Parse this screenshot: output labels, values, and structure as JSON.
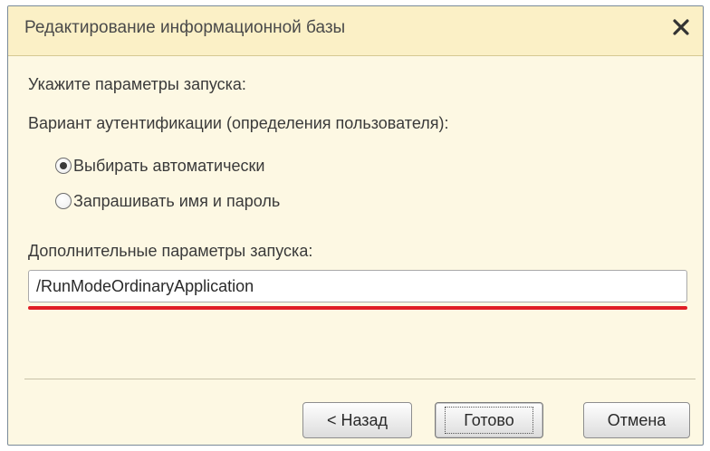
{
  "window": {
    "title": "Редактирование информационной базы",
    "close_symbol": "×",
    "close_icon": "close-icon"
  },
  "prompt": "Укажите параметры запуска:",
  "auth": {
    "label": "Вариант аутентификации (определения пользователя):",
    "options": [
      {
        "label": "Выбирать автоматически",
        "checked": true
      },
      {
        "label": "Запрашивать имя и пароль",
        "checked": false
      }
    ]
  },
  "extra_params": {
    "label": "Дополнительные параметры запуска:",
    "value": "/RunModeOrdinaryApplication",
    "highlight_color": "#e01e26"
  },
  "buttons": {
    "back": "< Назад",
    "finish": "Готово",
    "cancel": "Отмена"
  },
  "colors": {
    "window_bg": "#fdf8e3",
    "titlebar_bg": "#fbf0c6"
  }
}
